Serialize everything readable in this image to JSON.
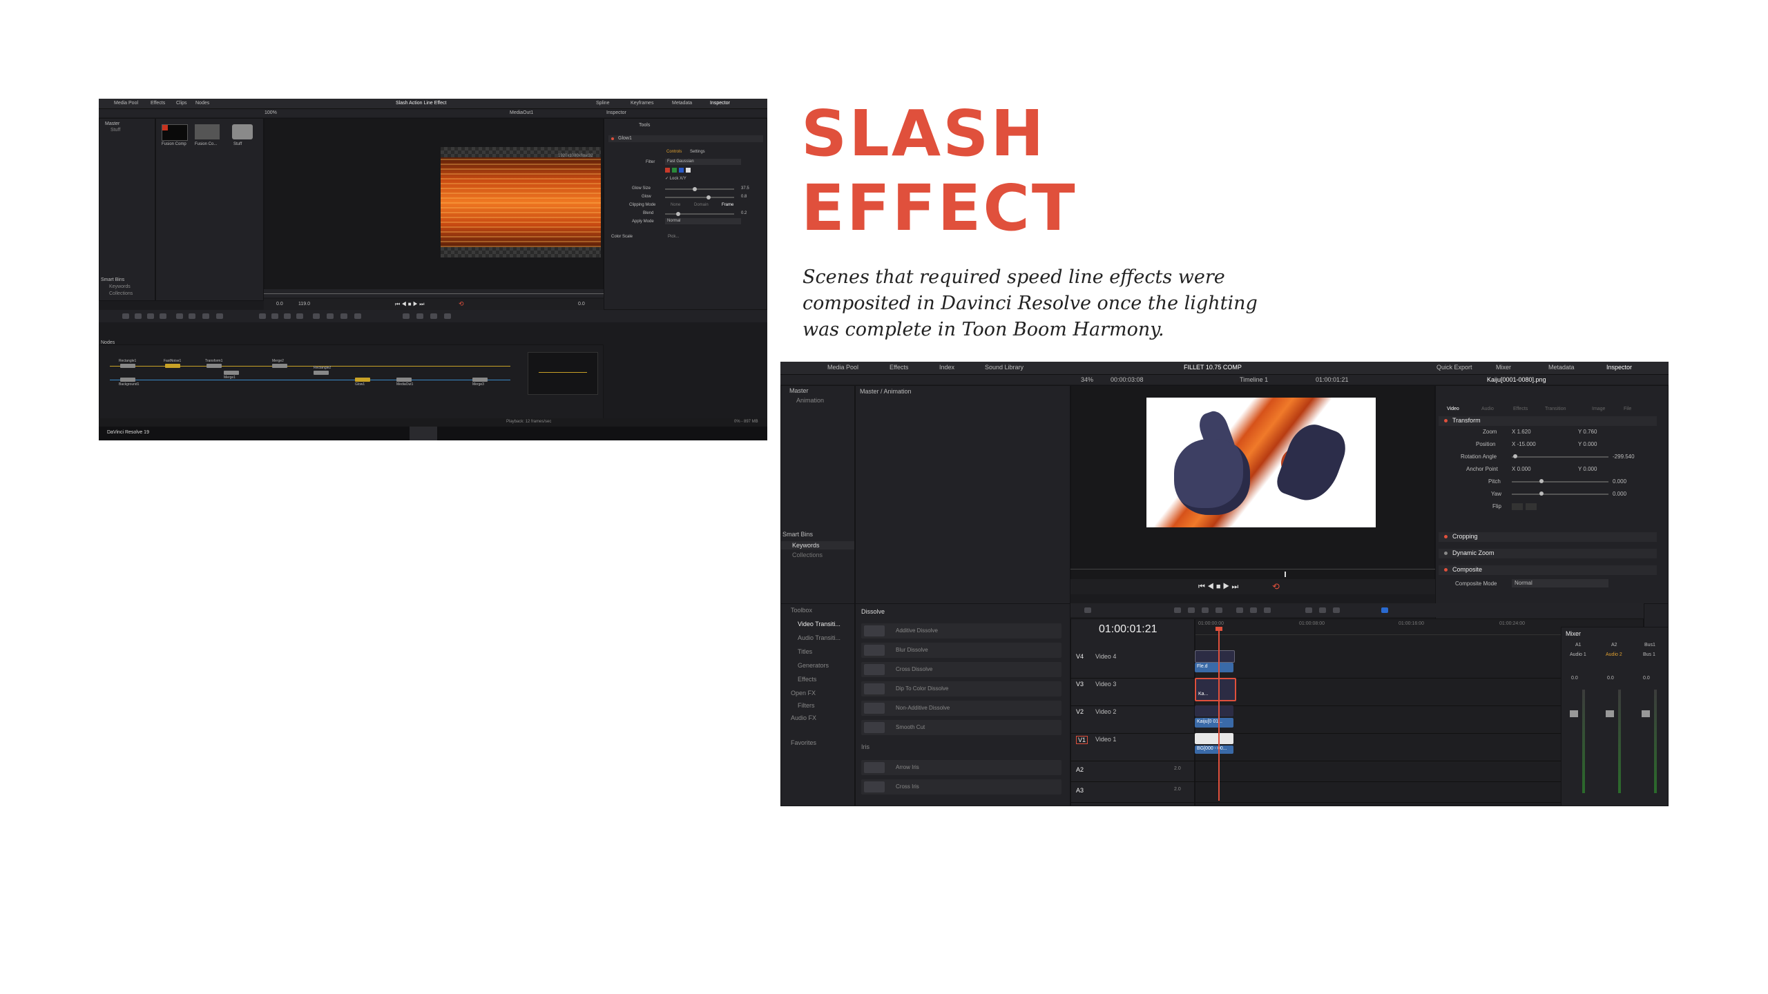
{
  "title": {
    "line1": "SLASH",
    "line2": "EFFECT"
  },
  "description": "Scenes that required speed line effects were composited in Davinci Resolve once the lighting was complete in Toon Boom Harmony.",
  "colors": {
    "accent": "#e0503c",
    "resolve_bg": "#1b1b1e",
    "fire": "#f07822",
    "playhead": "#e0503c"
  },
  "shot1": {
    "tabs": [
      "Media Pool",
      "Effects",
      "Clips",
      "Nodes"
    ],
    "window_title": "Slash Action Line Effect",
    "right_tabs": [
      "Spline",
      "Keyframes",
      "Metadata",
      "Inspector"
    ],
    "bin_tree": [
      "Master",
      "Stuff"
    ],
    "thumbs": [
      "Fusion Comp",
      "Fusion Co...",
      "Stuff"
    ],
    "smart_bins": [
      "Smart Bins",
      "Keywords",
      "Collections"
    ],
    "zoom": "100%",
    "viewer_label": "MediaOut1",
    "resolution_label": "1920x1080xfloat32",
    "inspector_label": "Inspector",
    "tools_label": "Tools",
    "node_name": "Glow1",
    "inspector_tabs": [
      "Controls",
      "Settings"
    ],
    "filter": {
      "label": "Filter",
      "value": "Fast Gaussian"
    },
    "lock_label": "Lock X/Y",
    "params": [
      {
        "label": "Glow Size",
        "value": "37.5"
      },
      {
        "label": "Glow",
        "value": "0.8"
      },
      {
        "label": "Clipping Mode",
        "value": "Frame"
      },
      {
        "label": "Blend",
        "value": "0.2"
      },
      {
        "label": "Apply Mode",
        "value": "Normal"
      }
    ],
    "clip_options": [
      "None",
      "Domain",
      "Frame"
    ],
    "color_scale_label": "Color Scale",
    "pick_label": "Pick...",
    "time_start": "0.0",
    "time_end": "119.0",
    "time_current": "0.0",
    "nodes_label": "Nodes",
    "node_labels": [
      "Rectangle1",
      "Background1",
      "FastNoise1",
      "Transform1",
      "Merge1",
      "Merge2",
      "Glow1",
      "MediaOut1",
      "Rectangle2",
      "Merge3"
    ],
    "playback_status": "Playback: 12 frames/sec",
    "memory": "0% - 897 MB",
    "app_name": "DaVinci Resolve 19"
  },
  "shot2": {
    "tabs": [
      "Media Pool",
      "Effects",
      "Index",
      "Sound Library"
    ],
    "window_title": "FILLET 10.75 COMP",
    "right_tabs": [
      "Quick Export",
      "Mixer",
      "Metadata",
      "Inspector"
    ],
    "bin_tree": [
      "Master",
      "Animation"
    ],
    "bin_path": "Master / Animation",
    "smart_bins": [
      "Smart Bins",
      "Keywords",
      "Collections"
    ],
    "zoom": "34%",
    "timecode_src": "00:00:03:08",
    "timeline_name": "Timeline 1",
    "timecode_rec": "01:00:01:21",
    "clip_name": "Kaiju[0001-0080].png",
    "inspector_tabs": [
      "Video",
      "Audio",
      "Effects",
      "Transition",
      "Image",
      "File"
    ],
    "transform_label": "Transform",
    "transform": [
      {
        "label": "Zoom",
        "x": "1.620",
        "y": "0.760"
      },
      {
        "label": "Position",
        "x": "-15.000",
        "y": "0.000"
      },
      {
        "label": "Rotation Angle",
        "value": "-299.540"
      },
      {
        "label": "Anchor Point",
        "x": "0.000",
        "y": "0.000"
      },
      {
        "label": "Pitch",
        "value": "0.000"
      },
      {
        "label": "Yaw",
        "value": "0.000"
      },
      {
        "label": "Flip",
        "value": ""
      }
    ],
    "sections": [
      "Cropping",
      "Dynamic Zoom",
      "Composite"
    ],
    "composite_mode": {
      "label": "Composite Mode",
      "value": "Normal"
    },
    "toolbox": [
      "Toolbox",
      "Video Transiti...",
      "Audio Transiti...",
      "Titles",
      "Generators",
      "Effects",
      "Open FX",
      "Filters",
      "Audio FX",
      "Favorites"
    ],
    "dissolve_label": "Dissolve",
    "dissolves": [
      "Additive Dissolve",
      "Blur Dissolve",
      "Cross Dissolve",
      "Dip To Color Dissolve",
      "Non-Additive Dissolve",
      "Smooth Cut"
    ],
    "iris_label": "Iris",
    "iris": [
      "Arrow Iris",
      "Cross Iris"
    ],
    "timeline_timecode": "01:00:01:21",
    "ruler": [
      "01:00:00:00",
      "01:00:08:00",
      "01:00:16:00",
      "01:00:24:00"
    ],
    "tracks": [
      {
        "id": "V4",
        "name": "Video 4",
        "clip": "Fle.d"
      },
      {
        "id": "V3",
        "name": "Video 3",
        "clip": "Ka..."
      },
      {
        "id": "V2",
        "name": "Video 2",
        "clip": "Kaiju[0 01..."
      },
      {
        "id": "V1",
        "name": "Video 1",
        "clip": "BG[000 - 00..."
      },
      {
        "id": "A2",
        "name": "",
        "clip": ""
      },
      {
        "id": "A3",
        "name": "",
        "clip": ""
      }
    ],
    "audio_gain": "2.0",
    "mixer_label": "Mixer",
    "mixer_cols": [
      "A1",
      "A2",
      "Bus1"
    ],
    "mixer_names": [
      "Audio 1",
      "Audio 2",
      "Bus 1"
    ],
    "mixer_values": [
      "0.0",
      "0.0",
      "0.0"
    ]
  }
}
